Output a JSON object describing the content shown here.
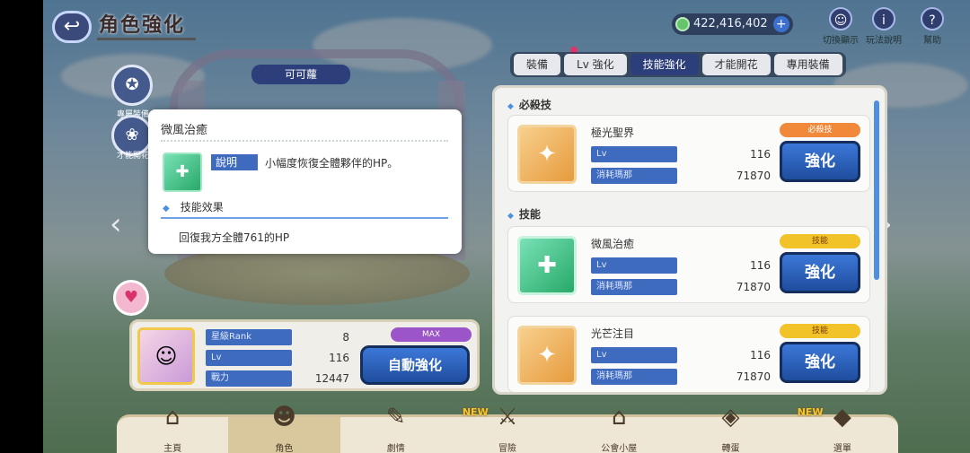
{
  "header": {
    "title": "角色強化",
    "currency_value": "422,416,402",
    "top_icons": [
      {
        "icon": "character-toggle-icon",
        "label": "切換顯示"
      },
      {
        "icon": "info-icon",
        "label": "玩法說明"
      },
      {
        "icon": "help-icon",
        "label": "幫助"
      }
    ]
  },
  "tabs": [
    "裝備",
    "Lv 強化",
    "技能強化",
    "才能開花",
    "專用裝備"
  ],
  "active_tab": "技能強化",
  "stage_banner": "可可蘿",
  "sections": {
    "ultimate": "必殺技",
    "skills": "技能"
  },
  "skill_cards": [
    {
      "name": "極光聖界",
      "lv_label": "Lv",
      "lv": "116",
      "cost_label": "消耗瑪那",
      "cost": "71870",
      "badge": "必殺技",
      "button": "強化"
    },
    {
      "name": "微風治癒",
      "lv_label": "Lv",
      "lv": "116",
      "cost_label": "消耗瑪那",
      "cost": "71870",
      "badge": "技能",
      "button": "強化"
    },
    {
      "name": "光芒注目",
      "lv_label": "Lv",
      "lv": "116",
      "cost_label": "消耗瑪那",
      "cost": "71870",
      "badge": "技能",
      "button": "強化"
    }
  ],
  "character": {
    "rank_label": "星級Rank",
    "rank": "8",
    "lv_label": "Lv",
    "lv": "116",
    "power_label": "戰力",
    "power": "12447",
    "max_pill": "MAX",
    "auto_button": "自動強化"
  },
  "bottom_nav": [
    {
      "label": "主頁",
      "icon": "home-icon",
      "new": ""
    },
    {
      "label": "角色",
      "icon": "character-icon",
      "new": ""
    },
    {
      "label": "劇情",
      "icon": "story-icon",
      "new": ""
    },
    {
      "label": "冒險",
      "icon": "adventure-icon",
      "new": "NEW"
    },
    {
      "label": "公會小屋",
      "icon": "guild-house-icon",
      "new": ""
    },
    {
      "label": "轉蛋",
      "icon": "gacha-icon",
      "new": ""
    },
    {
      "label": "選單",
      "icon": "menu-icon",
      "new": "NEW"
    }
  ],
  "popup": {
    "title": "微風治癒",
    "desc_label": "說明",
    "desc_text": "小幅度恢復全體夥伴的HP。",
    "effect_heading": "技能效果",
    "effect_text": "回復我方全體761的HP"
  },
  "side_labels": [
    "專屬裝備",
    "才能開花"
  ]
}
